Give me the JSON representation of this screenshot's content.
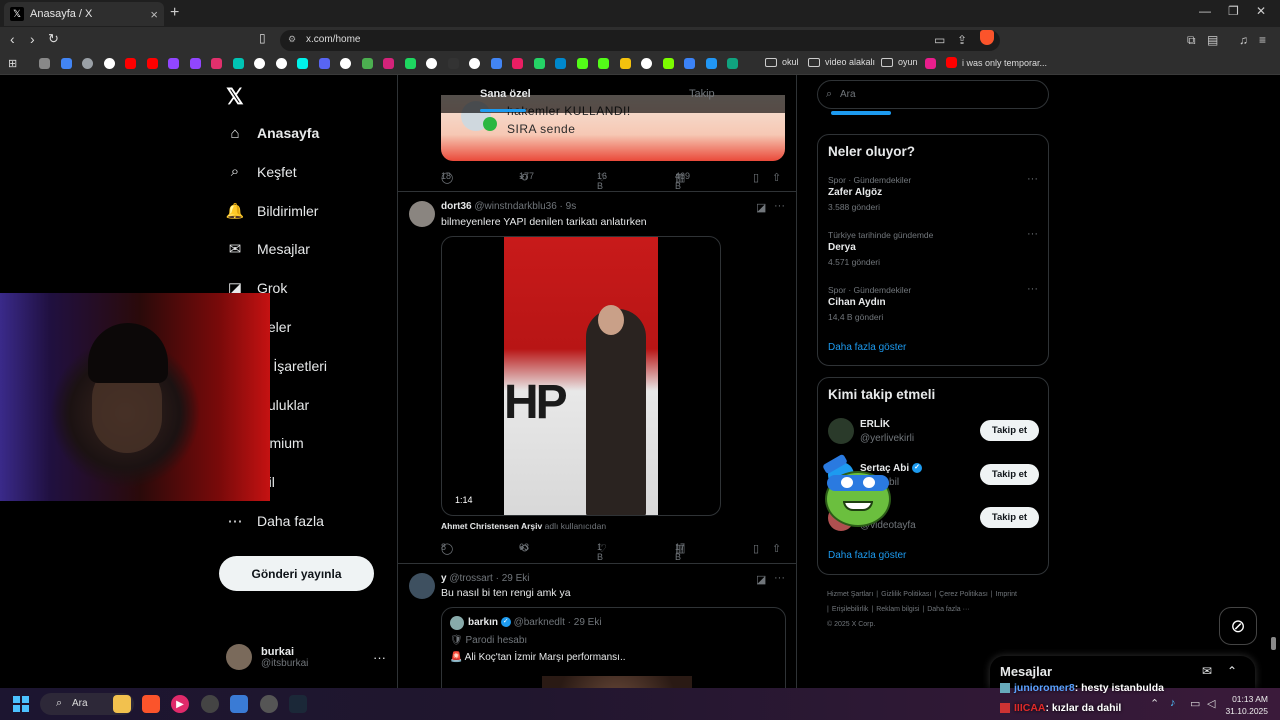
{
  "browser": {
    "tab_title": "Anasayfa / X",
    "tab_favicon": "𝕏",
    "url": "x.com/home",
    "bookmarks_folders": [
      "okul",
      "video alakalı",
      "oyun"
    ],
    "bookmark_last": "i was only temporar...",
    "bookmark_colors": [
      "#888888",
      "#4285f4",
      "#9aa0a6",
      "#ffffff",
      "#ff0000",
      "#ff0000",
      "#9146ff",
      "#9146ff",
      "#e1306c",
      "#00c4b4",
      "#ffffff",
      "#ffffff",
      "#00f2ea",
      "#5865f2",
      "#ffffff",
      "#4caf50",
      "#d4237a",
      "#1ed760",
      "#ffffff",
      "#333333",
      "#ffffff",
      "#4285f4",
      "#e91e63",
      "#25d366",
      "#0088cc",
      "#53fc18",
      "#53fc18",
      "#f4c20d",
      "#ffffff",
      "#7cfc00",
      "#3b82f6",
      "#2196f3",
      "#10a37f"
    ]
  },
  "nav": {
    "items": [
      {
        "label": "Anasayfa",
        "icon": "home-icon",
        "glyph": "⌂"
      },
      {
        "label": "Keşfet",
        "icon": "search-icon",
        "glyph": "⌕"
      },
      {
        "label": "Bildirimler",
        "icon": "bell-icon",
        "glyph": "🔔"
      },
      {
        "label": "Mesajlar",
        "icon": "mail-icon",
        "glyph": "✉"
      },
      {
        "label": "Grok",
        "icon": "grok-icon",
        "glyph": "◪"
      },
      {
        "label": "steler",
        "icon": "lists-icon",
        "glyph": ""
      },
      {
        "label": "er İşaretleri",
        "icon": "bookmark-icon",
        "glyph": ""
      },
      {
        "label": "pluluklar",
        "icon": "communities-icon",
        "glyph": ""
      },
      {
        "label": "remium",
        "icon": "premium-icon",
        "glyph": ""
      },
      {
        "label": "ofil",
        "icon": "profile-icon",
        "glyph": ""
      },
      {
        "label": "Daha fazla",
        "icon": "more-icon",
        "glyph": "⋯"
      }
    ],
    "post_button": "Gönderi yayınla",
    "user": {
      "name": "burkai",
      "handle": "@itsburkai"
    }
  },
  "timeline": {
    "tabs": [
      "Sana özel",
      "Takip"
    ],
    "promo": {
      "line1": "hakemler KULLANDI!",
      "line2": "SIRA sende"
    },
    "tweet0_stats": {
      "replies": "18",
      "reposts": "177",
      "likes": "16 B",
      "views": "469 B"
    },
    "tweet1": {
      "name": "dort36",
      "handle": "@winstndarkblu36",
      "time": "· 9s",
      "text": "bilmeyenlere YAPI denilen tarikatı anlatırken",
      "video_duration": "1:14",
      "video_logo_text": "HP",
      "source_name": "Ahmet Christensen Arşiv",
      "source_suffix": "adlı kullanıcıdan",
      "stats": {
        "replies": "8",
        "reposts": "63",
        "likes": "1 B",
        "views": "17 B"
      }
    },
    "tweet2": {
      "name": "y",
      "handle": "@trossart",
      "time": "· 29 Eki",
      "text": "Bu nasıl bi ten rengi amk ya",
      "quote": {
        "name": "barkın",
        "handle": "@barknedlt",
        "time": "· 29 Eki",
        "line1": "🛡 Parodi hesabı",
        "line2": "🚨 Ali Koç'tan İzmir Marşı performansı.."
      }
    }
  },
  "sidebar": {
    "search_placeholder": "Ara",
    "trends_title": "Neler oluyor?",
    "trends": [
      {
        "category": "Spor · Gündemdekiler",
        "name": "Zafer Algöz",
        "count": "3.588 gönderi"
      },
      {
        "category": "Türkiye tarihinde gündemde",
        "name": "Derya",
        "count": "4.571 gönderi"
      },
      {
        "category": "Spor · Gündemdekiler",
        "name": "Cihan Aydın",
        "count": "14,4 B gönderi"
      }
    ],
    "show_more": "Daha fazla göster",
    "follow_title": "Kimi takip etmeli",
    "follow": [
      {
        "name": "ERLİK",
        "handle": "@yerlivekirli",
        "button": "Takip et",
        "verified": false
      },
      {
        "name": "Sertaç Abi",
        "handle": "@tacabil",
        "button": "Takip et",
        "verified": true
      },
      {
        "name": "Tayfa",
        "handle": "@videotayfa",
        "button": "Takip et",
        "verified": false
      }
    ],
    "follow_show_more": "Daha fazla göster",
    "footer": [
      "Hizmet Şartları",
      "|",
      "Gizlilik Politikası",
      "|",
      "Çerez Politikası",
      "|",
      "Imprint",
      "|",
      "Erişilebilirlik",
      "|",
      "Reklam bilgisi",
      "|",
      "Daha fazla ···",
      "© 2025 X Corp."
    ]
  },
  "messages": {
    "title": "Mesajlar",
    "chat": [
      {
        "user": "junioromer8",
        "text": ": hesty istanbulda"
      },
      {
        "user": "IIICAA",
        "text": ": kızlar da dahil"
      }
    ]
  },
  "taskbar": {
    "search_label": "Ara",
    "time": "01:13 AM",
    "date": "31.10.2025"
  }
}
